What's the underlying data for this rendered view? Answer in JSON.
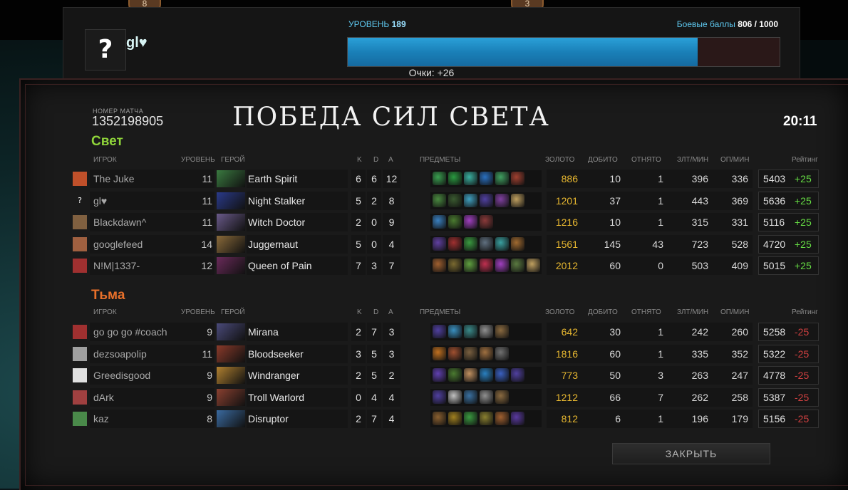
{
  "top": {
    "badge_left": "8",
    "badge_right": "3"
  },
  "profile": {
    "avatar_glyph": "?",
    "player_name": "gl♥",
    "level_label": "УРОВЕНЬ",
    "level_value": "189",
    "battle_label": "Боевые баллы",
    "battle_value": "806 / 1000",
    "xp_progress": 0.81,
    "points_text": "Очки: +26"
  },
  "match": {
    "id_label": "НОМЕР МАТЧА",
    "id": "1352198905",
    "result_title": "ПОБЕДА СИЛ СВЕТА",
    "duration": "20:11"
  },
  "headers": {
    "player": "ИГРОК",
    "level": "УРОВЕНЬ",
    "hero": "ГЕРОЙ",
    "k": "K",
    "d": "D",
    "a": "A",
    "items": "ПРЕДМЕТЫ",
    "gold": "ЗОЛОТО",
    "last_hits": "ДОБИТО",
    "denies": "ОТНЯТО",
    "gpm": "ЗЛТ/МИН",
    "xpm": "ОП/МИН",
    "rating": "Рейтинг"
  },
  "radiant": {
    "title": "Свет",
    "color": "#8fd43a",
    "players": [
      {
        "name": "The Juke",
        "level": "11",
        "hero": "Earth Spirit",
        "k": "6",
        "d": "6",
        "a": "12",
        "gold": "886",
        "lh": "10",
        "dn": "1",
        "gpm": "396",
        "xpm": "336",
        "rating": "5403",
        "delta": "+25",
        "icon_color": "#c0502a",
        "hero_color": "#3a7a40",
        "items": [
          "#3aa050",
          "#2a9a40",
          "#3ab0a0",
          "#2a70c0",
          "#40a060",
          "#a04030"
        ]
      },
      {
        "name": "gl♥",
        "level": "11",
        "hero": "Night Stalker",
        "k": "5",
        "d": "2",
        "a": "8",
        "gold": "1201",
        "lh": "37",
        "dn": "1",
        "gpm": "443",
        "xpm": "369",
        "rating": "5636",
        "delta": "+25",
        "icon_color": "#1a1a1a",
        "icon_glyph": "?",
        "hero_color": "#2a3a8a",
        "items": [
          "#4a8a40",
          "#3a5a30",
          "#40a0c0",
          "#5040a0",
          "#8040a0",
          "#c0a060"
        ]
      },
      {
        "name": "Blackdawn^",
        "level": "11",
        "hero": "Witch Doctor",
        "k": "2",
        "d": "0",
        "a": "9",
        "gold": "1216",
        "lh": "10",
        "dn": "1",
        "gpm": "315",
        "xpm": "331",
        "rating": "5116",
        "delta": "+25",
        "icon_color": "#806040",
        "hero_color": "#6a5a8a",
        "items": [
          "#3a80c0",
          "#4a7a30",
          "#a040c0",
          "#8a3a3a"
        ]
      },
      {
        "name": "googlefeed",
        "level": "14",
        "hero": "Juggernaut",
        "k": "5",
        "d": "0",
        "a": "4",
        "gold": "1561",
        "lh": "145",
        "dn": "43",
        "gpm": "723",
        "xpm": "528",
        "rating": "4720",
        "delta": "+25",
        "icon_color": "#a06040",
        "hero_color": "#8a6a3a",
        "items": [
          "#6040a0",
          "#a03030",
          "#3a9a40",
          "#607080",
          "#3aa0a0",
          "#a06a30"
        ]
      },
      {
        "name": "N!M|1337-",
        "level": "12",
        "hero": "Queen of Pain",
        "k": "7",
        "d": "3",
        "a": "7",
        "gold": "2012",
        "lh": "60",
        "dn": "0",
        "gpm": "503",
        "xpm": "409",
        "rating": "5015",
        "delta": "+25",
        "icon_color": "#a03030",
        "hero_color": "#6a2a5a",
        "items": [
          "#a06030",
          "#7a6a30",
          "#60a040",
          "#c03050",
          "#a040c0",
          "#5a7a40",
          "#c0a060"
        ]
      }
    ]
  },
  "dire": {
    "title": "Тьма",
    "color": "#e8702a",
    "players": [
      {
        "name": "go go go #coach",
        "level": "9",
        "hero": "Mirana",
        "k": "2",
        "d": "7",
        "a": "3",
        "gold": "642",
        "lh": "30",
        "dn": "1",
        "gpm": "242",
        "xpm": "260",
        "rating": "5258",
        "delta": "-25",
        "icon_color": "#a03030",
        "hero_color": "#4a4a7a",
        "items": [
          "#5040a0",
          "#3a90c0",
          "#3a8a8a",
          "#909090",
          "#8a6a40"
        ]
      },
      {
        "name": "dezsoapolip",
        "level": "11",
        "hero": "Bloodseeker",
        "k": "3",
        "d": "5",
        "a": "3",
        "gold": "1816",
        "lh": "60",
        "dn": "1",
        "gpm": "335",
        "xpm": "352",
        "rating": "5322",
        "delta": "-25",
        "icon_color": "#a0a0a0",
        "hero_color": "#8a3a2a",
        "items": [
          "#c07020",
          "#a05030",
          "#7a6040",
          "#a07040",
          "#707070"
        ]
      },
      {
        "name": "Greedisgood",
        "level": "9",
        "hero": "Windranger",
        "k": "2",
        "d": "5",
        "a": "2",
        "gold": "773",
        "lh": "50",
        "dn": "3",
        "gpm": "263",
        "xpm": "247",
        "rating": "4778",
        "delta": "-25",
        "icon_color": "#e0e0e0",
        "hero_color": "#b08030",
        "items": [
          "#6040b0",
          "#4a7a30",
          "#c09060",
          "#2a80c0",
          "#3a60c0",
          "#5040a0"
        ]
      },
      {
        "name": "dArk",
        "level": "9",
        "hero": "Troll Warlord",
        "k": "0",
        "d": "4",
        "a": "4",
        "gold": "1212",
        "lh": "66",
        "dn": "7",
        "gpm": "262",
        "xpm": "258",
        "rating": "5387",
        "delta": "-25",
        "icon_color": "#a04040",
        "hero_color": "#8a4030",
        "items": [
          "#5040a0",
          "#c0c0c0",
          "#3a70a0",
          "#909090",
          "#8a6a40"
        ]
      },
      {
        "name": "kaz",
        "level": "8",
        "hero": "Disruptor",
        "k": "2",
        "d": "7",
        "a": "4",
        "gold": "812",
        "lh": "6",
        "dn": "1",
        "gpm": "196",
        "xpm": "179",
        "rating": "5156",
        "delta": "-25",
        "icon_color": "#4a8a4a",
        "hero_color": "#3a6aa0",
        "items": [
          "#8a6030",
          "#a08020",
          "#3a9a40",
          "#8a8030",
          "#a06030",
          "#5a3aa0"
        ]
      }
    ]
  },
  "close_label": "ЗАКРЫТЬ"
}
